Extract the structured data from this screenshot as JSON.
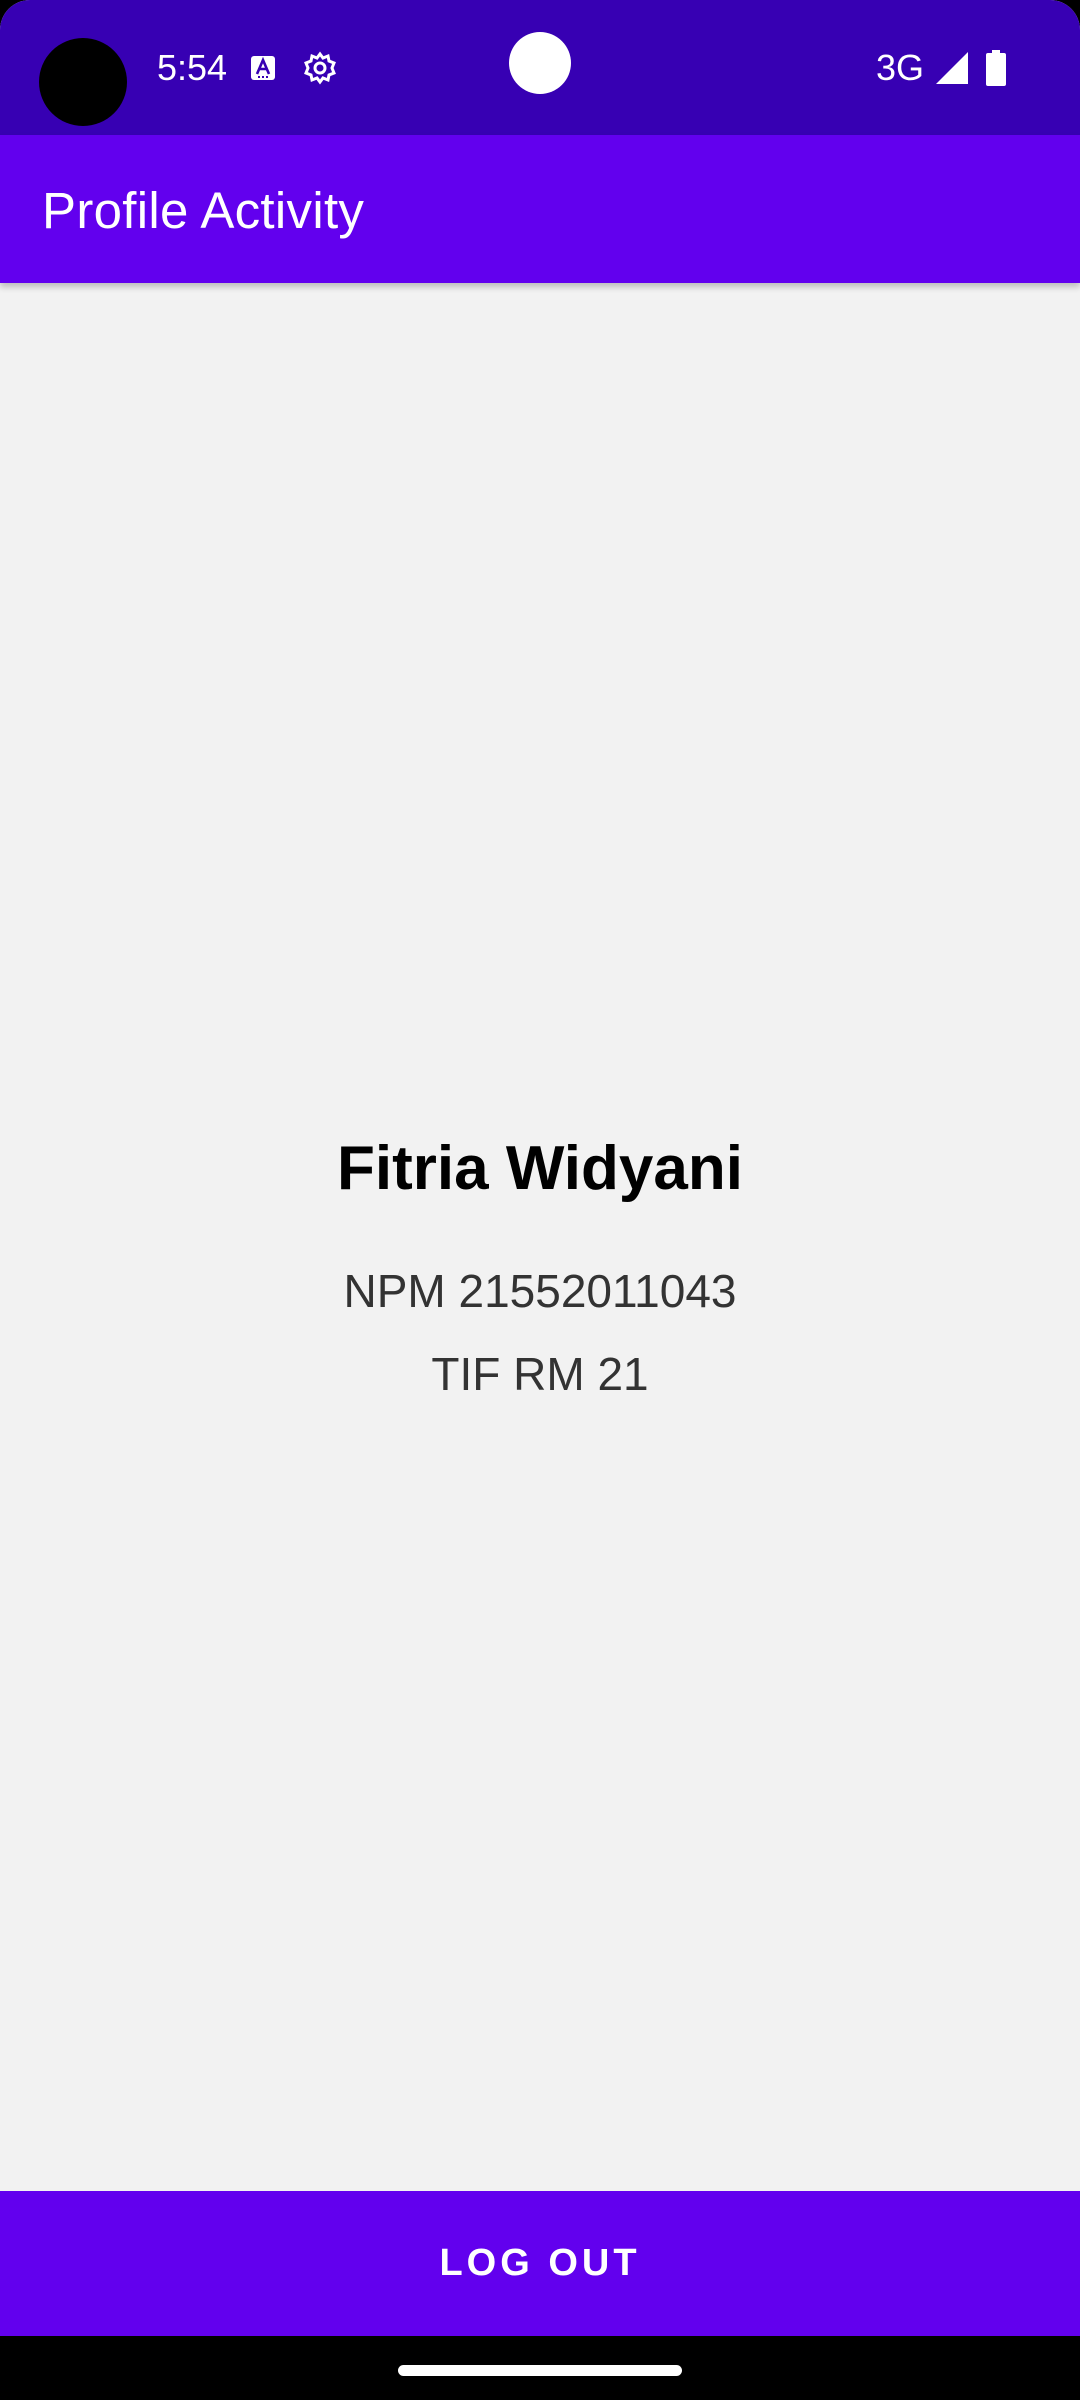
{
  "status_bar": {
    "time": "5:54",
    "network": "3G",
    "icons": [
      "text-a-notification-icon",
      "gear-icon",
      "signal-icon",
      "battery-icon"
    ]
  },
  "app_bar": {
    "title": "Profile Activity"
  },
  "profile": {
    "name": "Fitria Widyani",
    "npm": "NPM 21552011043",
    "class": "TIF RM 21"
  },
  "actions": {
    "logout_label": "LOG OUT"
  },
  "colors": {
    "status_bar": "#3700b3",
    "primary": "#6200ee",
    "background": "#f2f2f2"
  }
}
